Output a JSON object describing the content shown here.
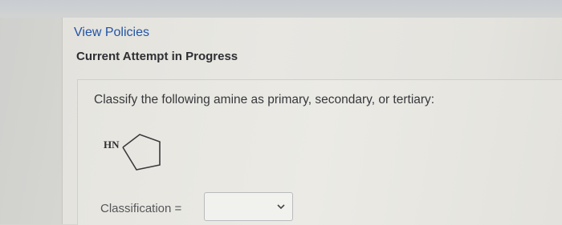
{
  "links": {
    "view_policies": "View Policies"
  },
  "header": {
    "attempt_title": "Current Attempt in Progress"
  },
  "question": {
    "prompt": "Classify the following amine as primary, secondary, or tertiary:",
    "molecule_label": "HN",
    "classification_label": "Classification =",
    "classification_value": "",
    "icons": {
      "dropdown": "chevron-down-icon"
    }
  },
  "colors": {
    "link": "#2255a5",
    "title_text": "#2e2f33",
    "body_text": "#37383c"
  }
}
